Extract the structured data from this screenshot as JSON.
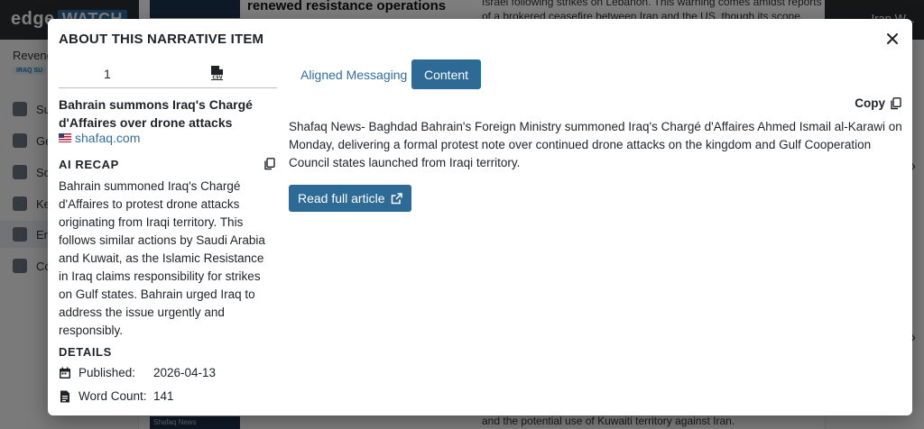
{
  "background": {
    "logo_text": "edge",
    "logo_box_text": "WATCH",
    "user_text": "Iran W...",
    "sidebar_title": "Revenge",
    "sidebar_tag": "IRAQ SU",
    "nav_items": [
      {
        "label": "Su"
      },
      {
        "label": "Ge"
      },
      {
        "label": "So"
      },
      {
        "label": "Ke"
      },
      {
        "label": "En"
      },
      {
        "label": "Co"
      }
    ],
    "card_title": "renewed resistance operations",
    "text_snippet": "Israel following strikes on Lebanon. This warning comes amidst reports of a brokered ceasefire between Iran and the US, though its scope,",
    "bottom_caption": "Shafaq News",
    "bottom_text": "and the potential use of Kuwaiti territory against Iran."
  },
  "modal": {
    "title": "ABOUT THIS NARRATIVE ITEM",
    "left": {
      "tab_number": "1",
      "csv_icon": "file-csv-icon",
      "article_title": "Bahrain summons Iraq's Chargé d'Affaires over drone attacks",
      "source": "shafaq.com",
      "ai_recap_heading": "AI RECAP",
      "ai_recap_text": "Bahrain summoned Iraq's Chargé d'Affaires to protest drone attacks originating from Iraqi territory. This follows similar actions by Saudi Arabia and Kuwait, as the Islamic Resistance in Iraq claims responsibility for strikes on Gulf states. Bahrain urged Iraq to address the issue urgently and responsibly.",
      "details_heading": "DETAILS",
      "published_label": "Published:",
      "published_value": "2026-04-13",
      "word_count_label": "Word Count:",
      "word_count_value": "141"
    },
    "right": {
      "tab_aligned": "Aligned Messaging",
      "tab_content": "Content",
      "copy_label": "Copy",
      "content_text": "Shafaq News- Baghdad Bahrain's Foreign Ministry summoned Iraq's Chargé d'Affaires Ahmed Ismail al-Karawi on Monday, delivering a formal protest note over continued drone attacks on the kingdom and Gulf Cooperation Council states launched from Iraqi territory.",
      "read_full_label": "Read full article"
    }
  },
  "colors": {
    "primary": "#2e6a96",
    "link": "#2f6fa3",
    "overlay": "rgba(0,0,0,0.5)"
  }
}
